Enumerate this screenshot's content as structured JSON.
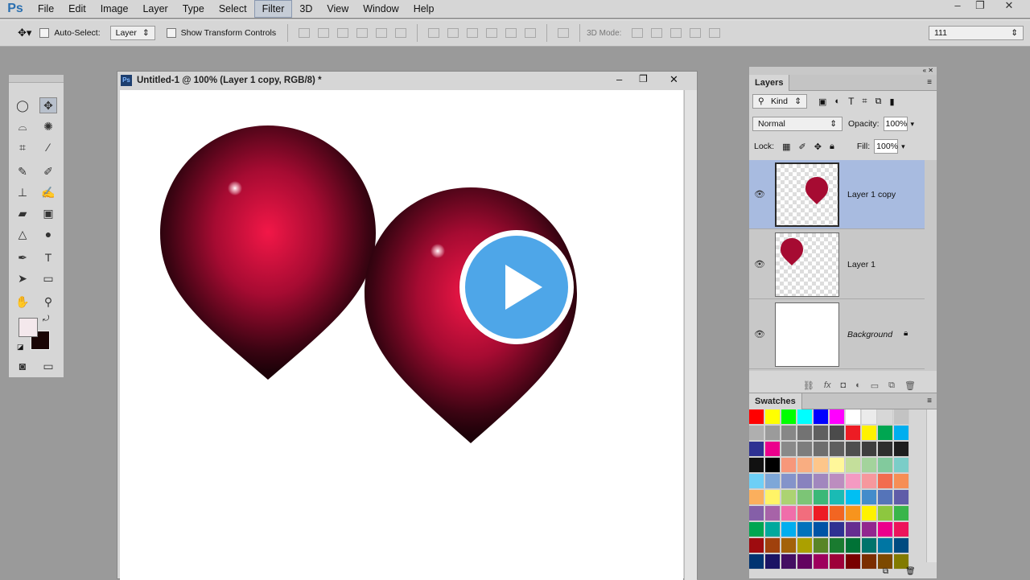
{
  "app": {
    "logo": "Ps"
  },
  "menu": [
    "File",
    "Edit",
    "Image",
    "Layer",
    "Type",
    "Select",
    "Filter",
    "3D",
    "View",
    "Window",
    "Help"
  ],
  "active_menu": "Filter",
  "options": {
    "auto_select_label": "Auto-Select:",
    "auto_select_value": "Layer",
    "show_transform_label": "Show Transform Controls",
    "mode_3d_label": "3D Mode:",
    "workspace_value": "111"
  },
  "document": {
    "title": "Untitled-1 @ 100% (Layer 1 copy, RGB/8) *"
  },
  "layers_panel": {
    "tab": "Layers",
    "kind_filter": "Kind",
    "blend_mode": "Normal",
    "opacity_label": "Opacity:",
    "opacity_value": "100%",
    "lock_label": "Lock:",
    "fill_label": "Fill:",
    "fill_value": "100%",
    "layers": [
      {
        "name": "Layer 1 copy",
        "selected": true
      },
      {
        "name": "Layer 1",
        "selected": false
      },
      {
        "name": "Background",
        "selected": false
      }
    ]
  },
  "swatches_panel": {
    "tab": "Swatches",
    "colors": [
      "#ff0000",
      "#ffff00",
      "#00ff00",
      "#00ffff",
      "#0000ff",
      "#ff00ff",
      "#ffffff",
      "#ebebeb",
      "#d7d7d7",
      "#c3c3c3",
      "#afafaf",
      "#9b9b9b",
      "#878787",
      "#737373",
      "#5f5f5f",
      "#4b4b4b",
      "#ed1c24",
      "#fff200",
      "#00a651",
      "#00aeef",
      "#2e3192",
      "#ec008c",
      "#898989",
      "#7d7d7d",
      "#6e6e6e",
      "#5e5e5e",
      "#4e4e4e",
      "#3e3e3e",
      "#2e2e2e",
      "#1e1e1e",
      "#111111",
      "#000000",
      "#f7977a",
      "#f9ad81",
      "#fdc68a",
      "#fff79a",
      "#c4df9b",
      "#a3d39c",
      "#82ca9d",
      "#7bcdc8",
      "#6ecff6",
      "#7ea7d8",
      "#8493ca",
      "#8882be",
      "#a187be",
      "#bc8dbf",
      "#f49ac2",
      "#f6989d",
      "#f26c4f",
      "#f68e55",
      "#fbaf5d",
      "#fff467",
      "#acd372",
      "#7cc576",
      "#3bb878",
      "#1abbb4",
      "#00bff3",
      "#438ccb",
      "#5574b9",
      "#605ca8",
      "#855fa8",
      "#a763a8",
      "#f06eaa",
      "#f26d7d",
      "#ed1c24",
      "#f26522",
      "#f7941d",
      "#fff200",
      "#8dc73f",
      "#39b54a",
      "#00a651",
      "#00a99d",
      "#00aeef",
      "#0072bc",
      "#0054a6",
      "#2e3192",
      "#662d91",
      "#92278f",
      "#ec008c",
      "#ed145b",
      "#9e0b0f",
      "#a0410d",
      "#a36209",
      "#aba000",
      "#598527",
      "#1a7b30",
      "#007236",
      "#00746b",
      "#0076a3",
      "#004b80",
      "#003471",
      "#1b1464",
      "#440e62",
      "#630460",
      "#9e005d",
      "#9e0039",
      "#790000",
      "#7b2e00",
      "#7d4900",
      "#827b00"
    ]
  },
  "colors": {
    "foreground": "#f4e8ec",
    "background": "#1a0505",
    "accent_selection": "#a8bbe0",
    "play_button": "#4ea6e8"
  },
  "icons": {
    "play": "play-icon"
  }
}
